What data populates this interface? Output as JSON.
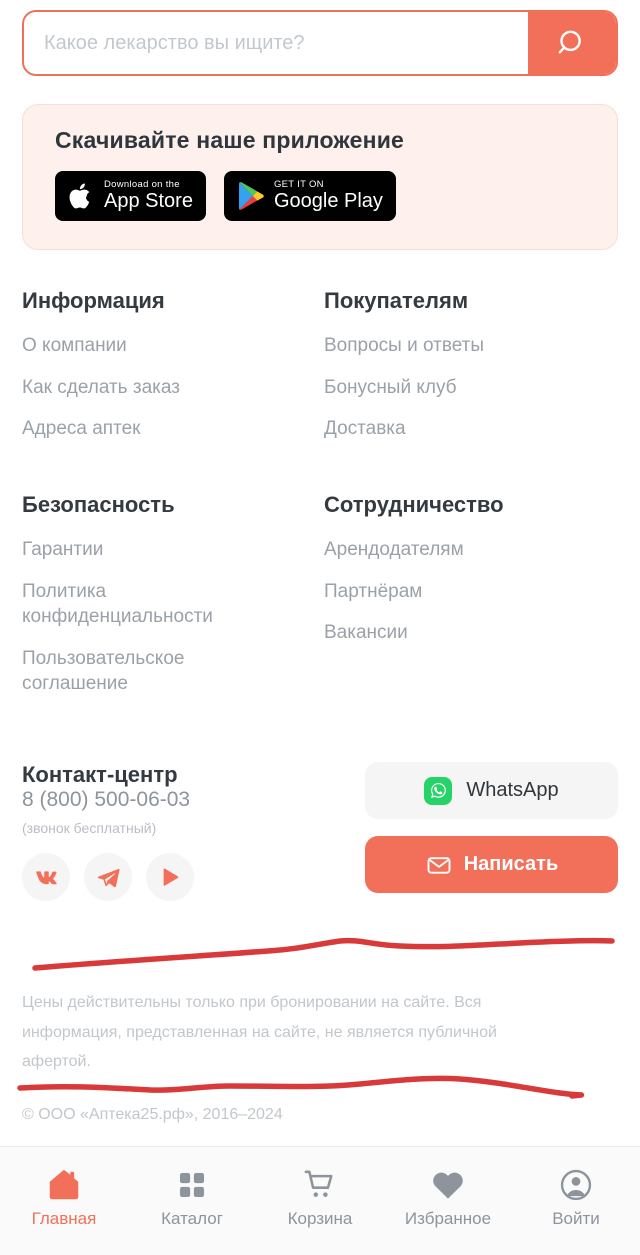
{
  "brand": {
    "accent": "#F2705A",
    "annotation_color": "#D83A3A",
    "muted": "#9AA1A8"
  },
  "search": {
    "placeholder": "Какое лекарство вы ищите?",
    "value": "",
    "icon": "search-icon"
  },
  "app_banner": {
    "title": "Скачивайте наше приложение",
    "badges": [
      {
        "icon": "apple-logo-icon",
        "top": "Download on the",
        "bottom": "App Store"
      },
      {
        "icon": "google-play-icon",
        "top": "GET IT ON",
        "bottom": "Google Play"
      }
    ]
  },
  "link_columns": [
    {
      "title": "Информация",
      "links": [
        "О компании",
        "Как сделать заказ",
        "Адреса аптек"
      ]
    },
    {
      "title": "Покупателям",
      "links": [
        "Вопросы и ответы",
        "Бонусный клуб",
        "Доставка"
      ]
    },
    {
      "title": "Безопасность",
      "links": [
        "Гарантии",
        "Политика конфиденциальности",
        "Пользовательское соглашение"
      ]
    },
    {
      "title": "Сотрудничество",
      "links": [
        "Арендодателям",
        "Партнёрам",
        "Вакансии"
      ]
    }
  ],
  "contact": {
    "title": "Контакт-центр",
    "phone": "8 (800) 500-06-03",
    "note": "(звонок бесплатный)",
    "socials": [
      {
        "name": "vk-icon",
        "label": "VK"
      },
      {
        "name": "telegram-icon",
        "label": "Telegram"
      },
      {
        "name": "youtube-play-icon",
        "label": "YouTube"
      }
    ],
    "whatsapp_label": "WhatsApp",
    "write_label": "Написать"
  },
  "legal": {
    "disclaimer": "Цены действительны только при бронировании на сайте. Вся информация, представленная на сайте, не является публичной афертой.",
    "copyright": "© ООО «Аптека25.рф», 2016–2024"
  },
  "bottom_nav": {
    "items": [
      {
        "label": "Главная",
        "icon": "home-icon",
        "active": true
      },
      {
        "label": "Каталог",
        "icon": "grid-icon",
        "active": false
      },
      {
        "label": "Корзина",
        "icon": "cart-icon",
        "active": false
      },
      {
        "label": "Избранное",
        "icon": "heart-icon",
        "active": false
      },
      {
        "label": "Войти",
        "icon": "user-circle-icon",
        "active": false
      }
    ]
  }
}
